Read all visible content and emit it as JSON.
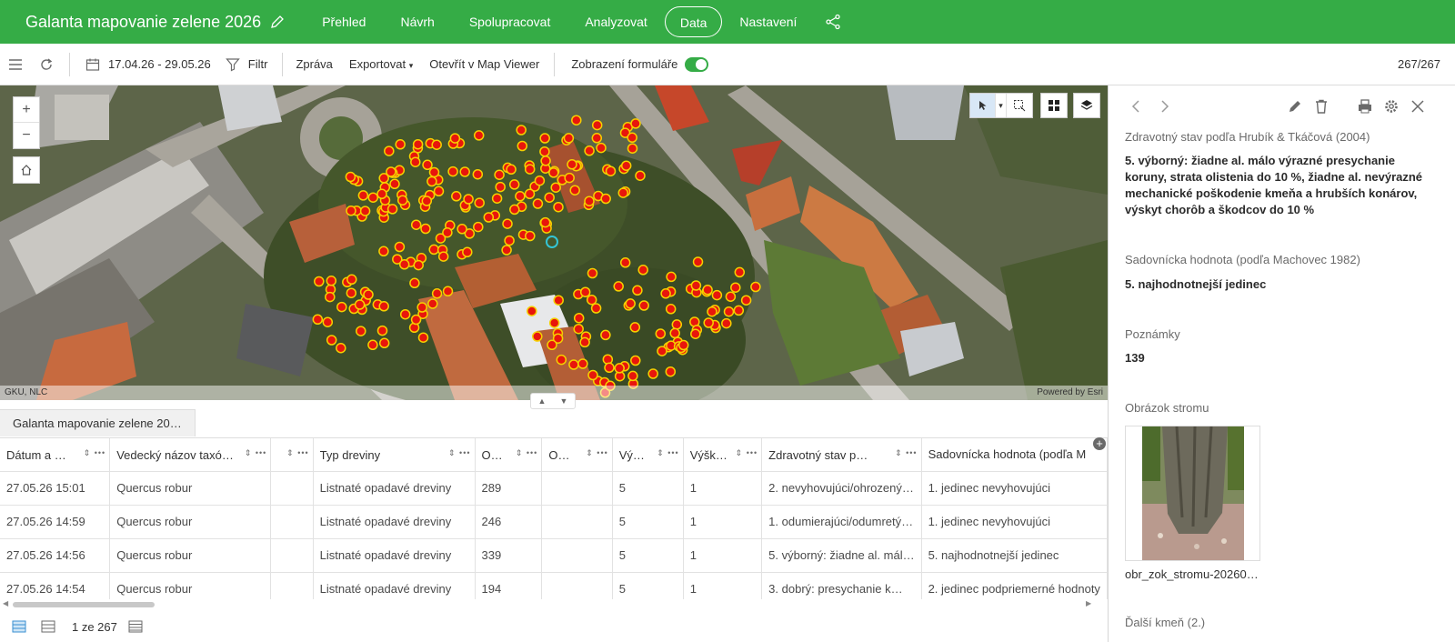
{
  "header": {
    "title": "Galanta mapovanie zelene 2026",
    "nav": [
      "Přehled",
      "Návrh",
      "Spolupracovat",
      "Analyzovat",
      "Data",
      "Nastavení"
    ],
    "active_tab": "Data"
  },
  "toolbar": {
    "date_range": "17.04.26 - 29.05.26",
    "filter": "Filtr",
    "report": "Zpráva",
    "export": "Exportovat",
    "open_map_viewer": "Otevřít v Map Viewer",
    "form_view": "Zobrazení formuláře",
    "form_view_on": true,
    "count": "267/267"
  },
  "map": {
    "attribution_left": "GKU, NLC",
    "attribution_right": "Powered by Esri",
    "point_fill": "#e8160c",
    "point_stroke": "#f5d000",
    "selected_color": "#33c5d6"
  },
  "table": {
    "tab_label": "Galanta mapovanie zelene 20…",
    "columns": [
      "Dátum a …",
      "Vedecký názov taxó…",
      "",
      "Typ dreviny",
      "O…",
      "O…",
      "Vý…",
      "Výšk…",
      "Zdravotný stav p…",
      "Sadovnícka hodnota (podľa M"
    ],
    "rows": [
      [
        "27.05.26 15:01",
        "Quercus robur",
        "",
        "Listnaté opadavé dreviny",
        "289",
        "",
        "5",
        "1",
        "2. nevyhovujúci/ohrozený…",
        "1. jedinec nevyhovujúci"
      ],
      [
        "27.05.26 14:59",
        "Quercus robur",
        "",
        "Listnaté opadavé dreviny",
        "246",
        "",
        "5",
        "1",
        "1. odumierajúci/odumretý…",
        "1. jedinec nevyhovujúci"
      ],
      [
        "27.05.26 14:56",
        "Quercus robur",
        "",
        "Listnaté opadavé dreviny",
        "339",
        "",
        "5",
        "1",
        "5. výborný: žiadne al. mál…",
        "5. najhodnotnejší jedinec"
      ],
      [
        "27.05.26 14:54",
        "Quercus robur",
        "",
        "Listnaté opadavé dreviny",
        "194",
        "",
        "5",
        "1",
        "3. dobrý: presychanie k…",
        "2. jedinec podpriemerné hodnoty"
      ]
    ],
    "page": "1 ze 267"
  },
  "panel": {
    "health_label": "Zdravotný stav podľa Hrubík & Tkáčová (2004)",
    "health_value": "5. výborný: žiadne al. málo výrazné presychanie koruny, strata olistenia do 10 %, žiadne al. nevýrazné mechanické poškodenie kmeňa a hrubších konárov, výskyt chorôb a škodcov do 10 %",
    "garden_label": "Sadovnícka hodnota (podľa Machovec 1982)",
    "garden_value": "5. najhodnotnejší jedinec",
    "notes_label": "Poznámky",
    "notes_value": "139",
    "image_label": "Obrázok stromu",
    "image_name": "obr_zok_stromu-20260…",
    "next_label": "Ďalší kmeň (2.)"
  },
  "colors": {
    "brand": "#35ac46"
  }
}
